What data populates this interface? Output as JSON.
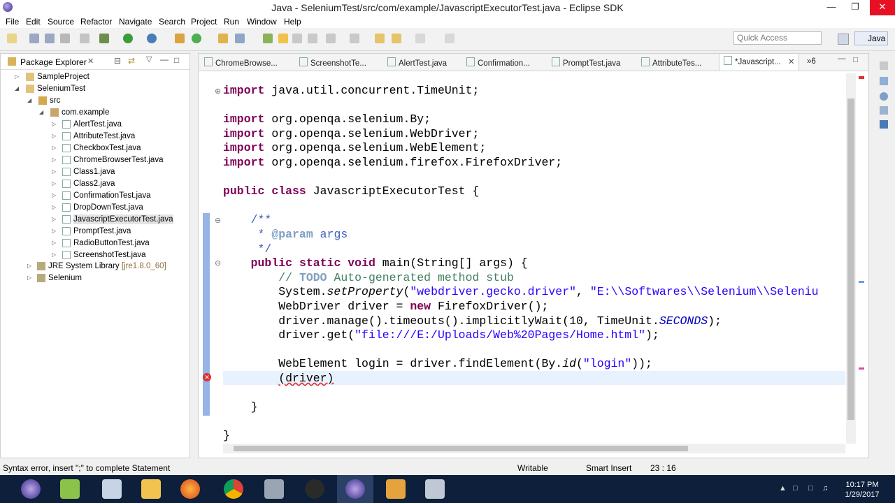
{
  "window": {
    "title": "Java - SeleniumTest/src/com/example/JavascriptExecutorTest.java - Eclipse SDK"
  },
  "menu": [
    "File",
    "Edit",
    "Source",
    "Refactor",
    "Navigate",
    "Search",
    "Project",
    "Run",
    "Window",
    "Help"
  ],
  "toolbar": {
    "quick_access_placeholder": "Quick Access",
    "perspective": "Java"
  },
  "package_explorer": {
    "title": "Package Explorer",
    "items": [
      "SampleProject",
      "SeleniumTest",
      "src",
      "com.example",
      "AlertTest.java",
      "AttributeTest.java",
      "CheckboxTest.java",
      "ChromeBrowserTest.java",
      "Class1.java",
      "Class2.java",
      "ConfirmationTest.java",
      "DropDownTest.java",
      "JavascriptExecutorTest.java",
      "PromptTest.java",
      "RadioButtonTest.java",
      "ScreenshotTest.java",
      "JRE System Library",
      "[jre1.8.0_60]",
      "Selenium"
    ]
  },
  "editor": {
    "tabs": [
      "ChromeBrowse...",
      "ScreenshotTe...",
      "AlertTest.java",
      "Confirmation...",
      "PromptTest.java",
      "AttributeTes...",
      "*Javascript...",
      "»6"
    ],
    "code": {
      "l1_kw": "import",
      "l1": " java.util.concurrent.TimeUnit;",
      "l2_kw": "import",
      "l2": " org.openqa.selenium.By;",
      "l3_kw": "import",
      "l3": " org.openqa.selenium.WebDriver;",
      "l4_kw": "import",
      "l4": " org.openqa.selenium.WebElement;",
      "l5_kw": "import",
      "l5": " org.openqa.selenium.firefox.FirefoxDriver;",
      "cls_kw1": "public",
      "cls_kw2": "class",
      "cls": " JavascriptExecutorTest {",
      "jd1": "    /**",
      "jd2_a": "     * ",
      "jd2_tag": "@param",
      "jd2_b": " args",
      "jd3": "     */",
      "m_kw1": "public",
      "m_kw2": "static",
      "m_kw3": "void",
      "m": " main(String[] args) {",
      "todo_a": "// ",
      "todo": "TODO",
      "todo_b": " Auto-generated method stub",
      "s1_a": "System.",
      "s1_b": "setProperty",
      "s1_c": "(",
      "s1_d": "\"webdriver.gecko.driver\"",
      "s1_e": ", ",
      "s1_f": "\"E:\\\\Softwares\\\\Selenium\\\\Seleniu",
      "s2_a": "WebDriver driver = ",
      "s2_kw": "new",
      "s2_b": " FirefoxDriver();",
      "s3_a": "driver.manage().timeouts().implicitlyWait(10, TimeUnit.",
      "s3_b": "SECONDS",
      "s3_c": ");",
      "s4_a": "driver.get(",
      "s4_b": "\"file:///E:/Uploads/Web%20Pages/Home.html\"",
      "s4_c": ");",
      "s5_a": "WebElement login = driver.findElement(By.",
      "s5_b": "id",
      "s5_c": "(",
      "s5_d": "\"login\"",
      "s5_e": "));",
      "s6": "(driver)",
      "close1": "    }",
      "close2": "}"
    }
  },
  "status_bar": {
    "message": "Syntax error, insert \";\" to complete Statement",
    "writable": "Writable",
    "insert_mode": "Smart Insert",
    "position": "23 : 16"
  },
  "taskbar": {
    "time": "10:17 PM",
    "date": "1/29/2017"
  }
}
